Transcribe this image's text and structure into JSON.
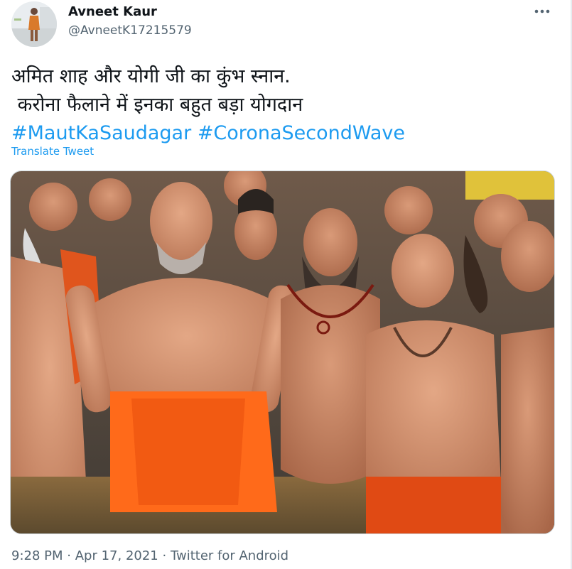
{
  "author": {
    "name": "Avneet Kaur",
    "handle": "@AvneetK17215579"
  },
  "tweet": {
    "line1": "अमित शाह और योगी जी का कुंभ स्नान.",
    "line2": " करोना फैलाने में इनका बहुत बड़ा योगदान",
    "hashtags": [
      "#MautKaSaudagar",
      "#CoronaSecondWave"
    ]
  },
  "translate_label": "Translate Tweet",
  "meta": {
    "time": "9:28 PM",
    "separator": "·",
    "date": "Apr 17, 2021",
    "source": "Twitter for Android"
  },
  "icons": {
    "more": "more-horizontal-icon"
  },
  "colors": {
    "link_blue": "#1d9bf0",
    "secondary_text": "#536471",
    "primary_text": "#0f1419"
  }
}
